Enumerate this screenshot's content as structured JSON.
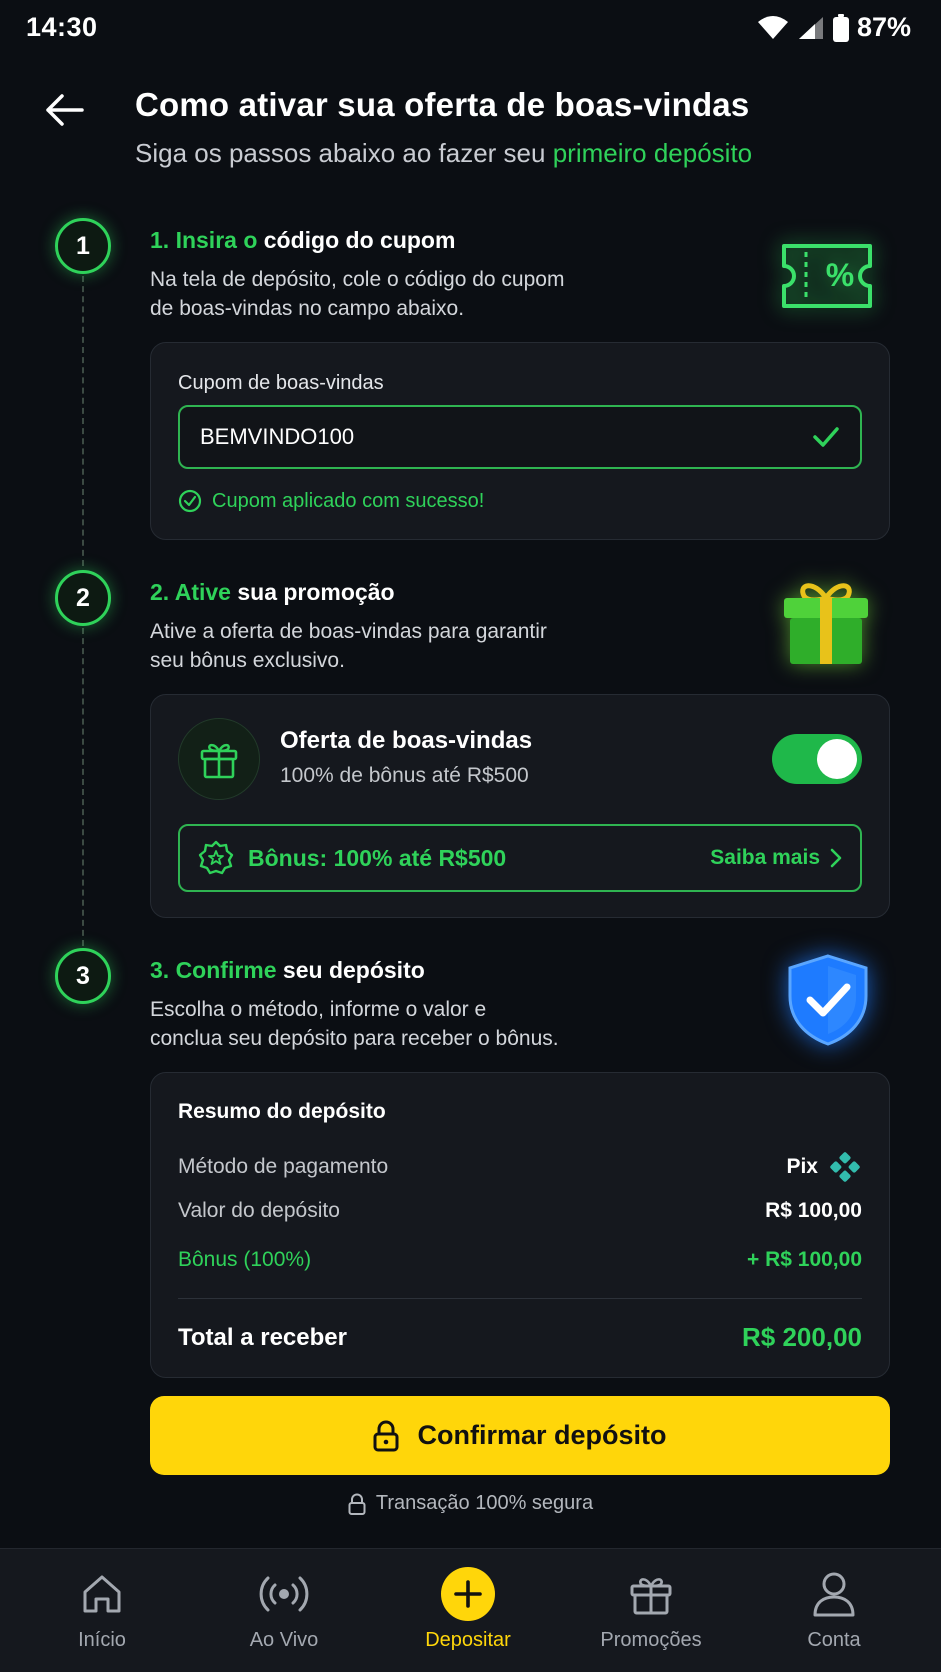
{
  "status_bar": {
    "time": "14:30",
    "battery": "87%"
  },
  "header": {
    "title": "Como ativar sua oferta de boas-vindas",
    "subtitle_prefix": "Siga os passos abaixo ao fazer seu ",
    "subtitle_highlight": "primeiro depósito"
  },
  "steps": [
    {
      "number": "1",
      "title_highlight": "1. Insira o",
      "title_rest": " código do cupom",
      "desc_line1": "Na tela de depósito, cole o código do cupom",
      "desc_line2": "de boas-vindas no campo abaixo.",
      "illustration": "coupon-percent-icon"
    },
    {
      "number": "2",
      "title_highlight": "2. Ative",
      "title_rest": " sua promoção",
      "desc_line1": "Ative a oferta de boas-vindas para garantir",
      "desc_line2": "seu bônus exclusivo.",
      "illustration": "gift-box-icon"
    },
    {
      "number": "3",
      "title_highlight": "3. Confirme",
      "title_rest": " seu depósito",
      "desc_line1": "Escolha o método, informe o valor e",
      "desc_line2": "conclua seu depósito para receber o bônus.",
      "illustration": "shield-check-icon"
    }
  ],
  "coupon": {
    "label": "Cupom de boas-vindas",
    "value": "BEMVINDO100",
    "success_message": "Cupom aplicado com sucesso!"
  },
  "offer": {
    "title": "Oferta de boas-vindas",
    "subtitle": "100% de bônus até R$500",
    "toggle_on": true,
    "bonus_label": "Bônus: 100% até R$500",
    "learn_more": "Saiba mais"
  },
  "summary": {
    "title": "Resumo do depósito",
    "rows": [
      {
        "label": "Método de pagamento",
        "value": "Pix"
      },
      {
        "label": "Valor do depósito",
        "value": "R$ 100,00"
      },
      {
        "label": "Bônus (100%)",
        "value": "+ R$ 100,00"
      }
    ],
    "total_label": "Total a receber",
    "total_value": "R$ 200,00"
  },
  "confirm_button": "Confirmar depósito",
  "secure_note": "Transação 100% segura",
  "bottom_nav": [
    {
      "label": "Início",
      "icon": "home-icon"
    },
    {
      "label": "Ao Vivo",
      "icon": "live-icon"
    },
    {
      "label": "Depositar",
      "icon": "plus-icon",
      "active": true
    },
    {
      "label": "Promoções",
      "icon": "gift-icon"
    },
    {
      "label": "Conta",
      "icon": "user-icon"
    }
  ],
  "colors": {
    "accent": "#2fd25a",
    "primary_button": "#ffd60a",
    "background": "#0b0e13",
    "card": "#15181e",
    "shield": "#1e7bff"
  }
}
